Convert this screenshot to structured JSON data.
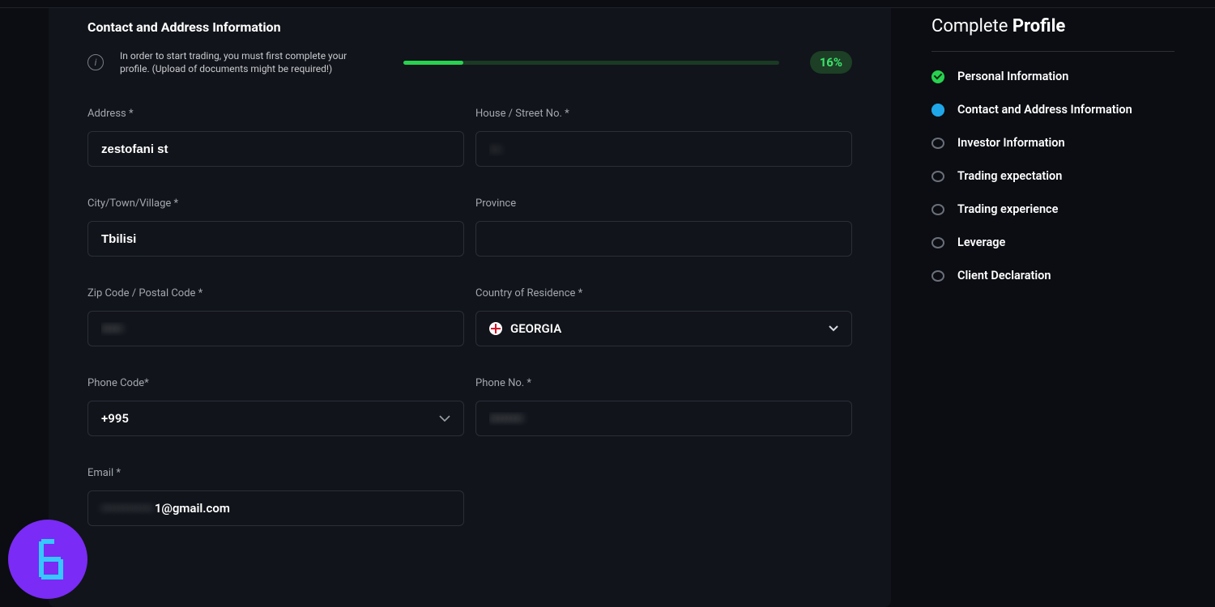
{
  "header": {
    "title": "Contact and Address Information"
  },
  "notice": {
    "text": "In order to start trading, you must first complete your profile. (Upload of documents might be required!)"
  },
  "progress": {
    "percent": 16,
    "label": "16%"
  },
  "fields": {
    "address": {
      "label": "Address *",
      "value": "zestofani st"
    },
    "house": {
      "label": "House / Street No. *",
      "value": "—"
    },
    "city": {
      "label": "City/Town/Village *",
      "value": "Tbilisi"
    },
    "province": {
      "label": "Province",
      "value": ""
    },
    "zip": {
      "label": "Zip Code / Postal Code *",
      "value": "•••••"
    },
    "country": {
      "label": "Country of Residence *",
      "value": "GEORGIA"
    },
    "phonecode": {
      "label": "Phone Code*",
      "value": "+995"
    },
    "phone": {
      "label": "Phone No. *",
      "value": "••••••••"
    },
    "email": {
      "label": "Email *",
      "value": "1@gmail.com",
      "masked_prefix": "••••••••••••"
    }
  },
  "sidebar": {
    "title_light": "Complete ",
    "title_bold": "Profile",
    "steps": [
      {
        "label": "Personal Information",
        "state": "done"
      },
      {
        "label": "Contact and Address Information",
        "state": "current"
      },
      {
        "label": "Investor Information",
        "state": "pending"
      },
      {
        "label": "Trading expectation",
        "state": "pending"
      },
      {
        "label": "Trading experience",
        "state": "pending"
      },
      {
        "label": "Leverage",
        "state": "pending"
      },
      {
        "label": "Client Declaration",
        "state": "pending"
      }
    ]
  },
  "colors": {
    "accent_green": "#28d24f",
    "accent_blue": "#1fa6e8",
    "fab_purple": "#7a2bf5"
  }
}
